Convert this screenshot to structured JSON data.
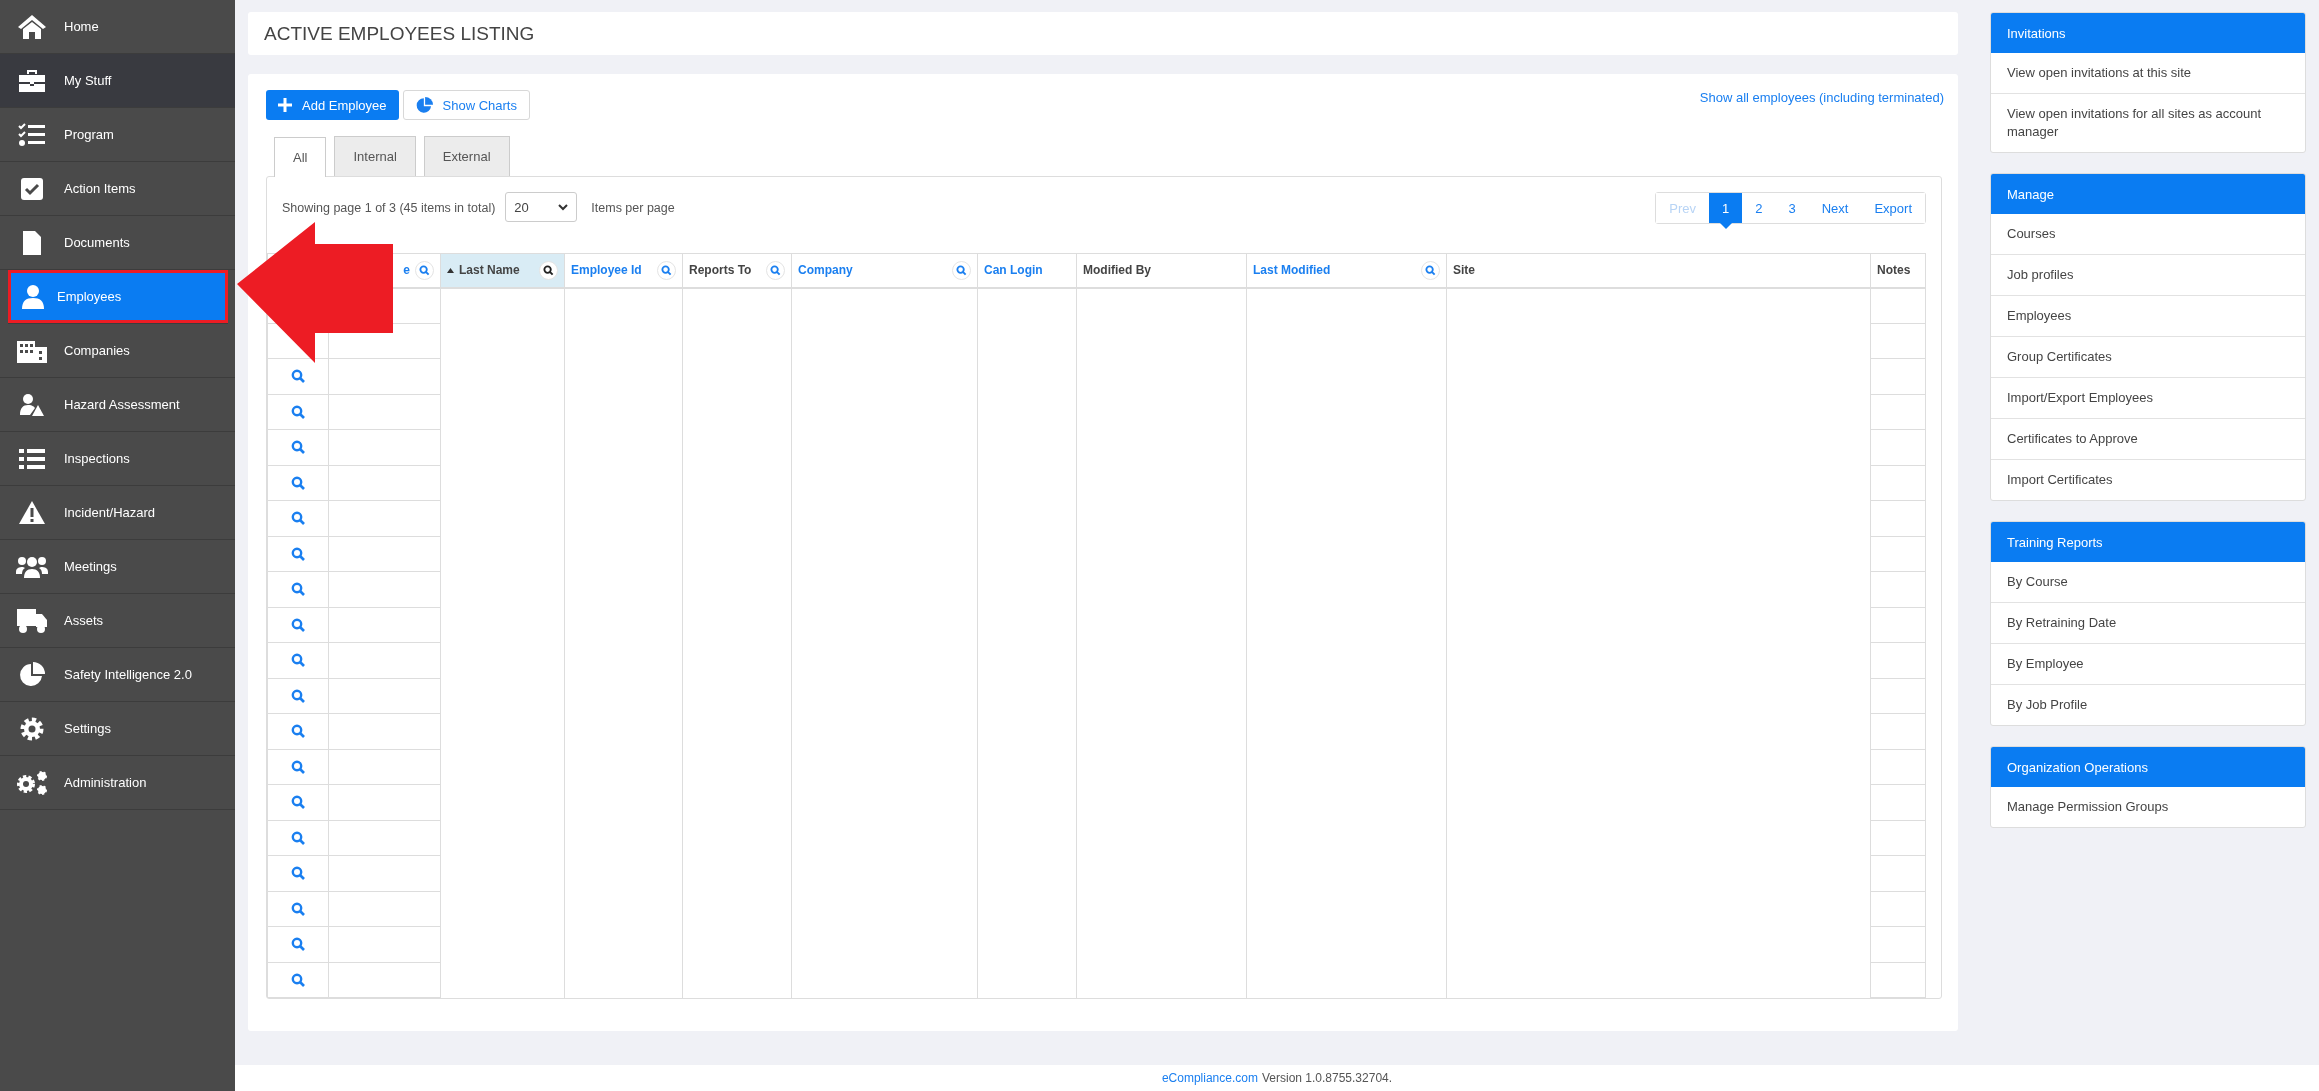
{
  "sidebar": {
    "items": [
      {
        "label": "Home",
        "kind": "home",
        "selected": false,
        "current": false,
        "outlined": false
      },
      {
        "label": "My Stuff",
        "kind": "briefcase",
        "selected": false,
        "current": true,
        "outlined": false
      },
      {
        "label": "Program",
        "kind": "checklist",
        "selected": false,
        "current": false,
        "outlined": false
      },
      {
        "label": "Action Items",
        "kind": "checkbox",
        "selected": false,
        "current": false,
        "outlined": false
      },
      {
        "label": "Documents",
        "kind": "document",
        "selected": false,
        "current": false,
        "outlined": false
      },
      {
        "label": "Employees",
        "kind": "person",
        "selected": true,
        "current": false,
        "outlined": true
      },
      {
        "label": "Companies",
        "kind": "building",
        "selected": false,
        "current": false,
        "outlined": false
      },
      {
        "label": "Hazard Assessment",
        "kind": "person-warning",
        "selected": false,
        "current": false,
        "outlined": false
      },
      {
        "label": "Inspections",
        "kind": "list",
        "selected": false,
        "current": false,
        "outlined": false
      },
      {
        "label": "Incident/Hazard",
        "kind": "warning",
        "selected": false,
        "current": false,
        "outlined": false
      },
      {
        "label": "Meetings",
        "kind": "group",
        "selected": false,
        "current": false,
        "outlined": false
      },
      {
        "label": "Assets",
        "kind": "truck",
        "selected": false,
        "current": false,
        "outlined": false
      },
      {
        "label": "Safety Intelligence 2.0",
        "kind": "pie",
        "selected": false,
        "current": false,
        "outlined": false
      },
      {
        "label": "Settings",
        "kind": "gear",
        "selected": false,
        "current": false,
        "outlined": false
      },
      {
        "label": "Administration",
        "kind": "gears",
        "selected": false,
        "current": false,
        "outlined": false
      }
    ]
  },
  "arrow_annotation": true,
  "page_title": "ACTIVE EMPLOYEES LISTING",
  "toolbar": {
    "add_button": "Add Employee",
    "charts_button": "Show Charts",
    "show_all_link": "Show all employees (including terminated)"
  },
  "tabs": [
    {
      "label": "All",
      "selected": true
    },
    {
      "label": "Internal",
      "selected": false
    },
    {
      "label": "External",
      "selected": false
    }
  ],
  "paging": {
    "summary": "Showing page 1 of 3 (45 items in total)",
    "per_page": "20",
    "per_page_label": "Items per page",
    "pages": [
      {
        "label": "Prev",
        "selected": false,
        "disabled": true
      },
      {
        "label": "1",
        "selected": true,
        "disabled": false
      },
      {
        "label": "2",
        "selected": false,
        "disabled": false
      },
      {
        "label": "3",
        "selected": false,
        "disabled": false
      },
      {
        "label": "Next",
        "selected": false,
        "disabled": false
      },
      {
        "label": "Export",
        "selected": false,
        "disabled": false
      }
    ]
  },
  "table": {
    "columns": [
      {
        "kind": "view"
      },
      {
        "kind": "data",
        "label": "e",
        "link": true,
        "sorted": false,
        "filter": true
      },
      {
        "kind": "data",
        "label": "Last Name",
        "link": false,
        "sorted": true,
        "filter": true
      },
      {
        "kind": "data",
        "label": "Employee Id",
        "link": true,
        "sorted": false,
        "filter": true
      },
      {
        "kind": "data",
        "label": "Reports To",
        "link": false,
        "sorted": false,
        "filter": true
      },
      {
        "kind": "data",
        "label": "Company",
        "link": true,
        "sorted": false,
        "filter": true
      },
      {
        "kind": "data",
        "label": "Can Login",
        "link": true,
        "sorted": false,
        "filter": false
      },
      {
        "kind": "data",
        "label": "Modified By",
        "link": false,
        "sorted": false,
        "filter": false
      },
      {
        "kind": "data",
        "label": "Last Modified",
        "link": true,
        "sorted": false,
        "filter": true
      },
      {
        "kind": "data",
        "label": "Site",
        "link": false,
        "sorted": false,
        "filter": false
      },
      {
        "kind": "data",
        "label": "Notes",
        "link": false,
        "sorted": false,
        "filter": false
      }
    ],
    "rows": [
      {
        "kind": "covered"
      },
      {
        "kind": "covered"
      },
      {
        "kind": "row"
      },
      {
        "kind": "row"
      },
      {
        "kind": "row"
      },
      {
        "kind": "row"
      },
      {
        "kind": "row"
      },
      {
        "kind": "row"
      },
      {
        "kind": "row"
      },
      {
        "kind": "row"
      },
      {
        "kind": "row"
      },
      {
        "kind": "row"
      },
      {
        "kind": "row"
      },
      {
        "kind": "row"
      },
      {
        "kind": "row"
      },
      {
        "kind": "row"
      },
      {
        "kind": "row"
      },
      {
        "kind": "row"
      },
      {
        "kind": "row"
      },
      {
        "kind": "row"
      }
    ]
  },
  "panels": [
    {
      "title": "Invitations",
      "items": [
        "View open invitations at this site",
        "View open invitations for all sites as account manager"
      ]
    },
    {
      "title": "Manage",
      "items": [
        "Courses",
        "Job profiles",
        "Employees",
        "Group Certificates",
        "Import/Export Employees",
        "Certificates to Approve",
        "Import Certificates"
      ]
    },
    {
      "title": "Training Reports",
      "items": [
        "By Course",
        "By Retraining Date",
        "By Employee",
        "By Job Profile"
      ]
    },
    {
      "title": "Organization Operations",
      "items": [
        "Manage Permission Groups"
      ]
    }
  ],
  "footer": {
    "link": "eCompliance.com",
    "version": "Version 1.0.8755.32704."
  }
}
